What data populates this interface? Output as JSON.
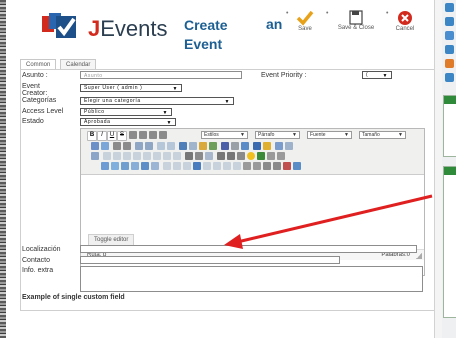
{
  "app": {
    "logo_text_j": "J",
    "logo_text_rest": "Events",
    "title_line1": "Create",
    "title_line2": "Event",
    "title_suffix": "an"
  },
  "toolbar": {
    "save_label": "Save",
    "save_close_label": "Save & Close",
    "cancel_label": "Cancel"
  },
  "tabs": [
    {
      "label": "Common"
    },
    {
      "label": "Calendar"
    }
  ],
  "form": {
    "title_label": "Asunto :",
    "title_value": "Asunto",
    "priority_label": "Event Priority :",
    "priority_value": "(",
    "creator_label_1": "Event",
    "creator_label_2": "Creator:",
    "creator_value": "Super User ( admin )",
    "category_label": "Categorías",
    "category_value": "Elegir una categoría",
    "access_label": "Access Level",
    "access_value": "Público",
    "state_label": "Estado",
    "state_value": "Aprobada",
    "location_label": "Localización",
    "contact_label": "Contacto",
    "extra_label": "Info. extra",
    "custom_field_label": "Example of single custom field"
  },
  "editor": {
    "styles_select": "Estilos",
    "paragraph_select": "Párrafo",
    "font_select": "Fuente",
    "size_select": "Tamaño",
    "path_label": "Ruta: p",
    "words_label": "Palabras:0",
    "toggle_label": "Toggle editor"
  },
  "colors": {
    "brand_red": "#d32a1e",
    "title_blue": "#1c5f93",
    "annotation_arrow": "#e02020"
  }
}
